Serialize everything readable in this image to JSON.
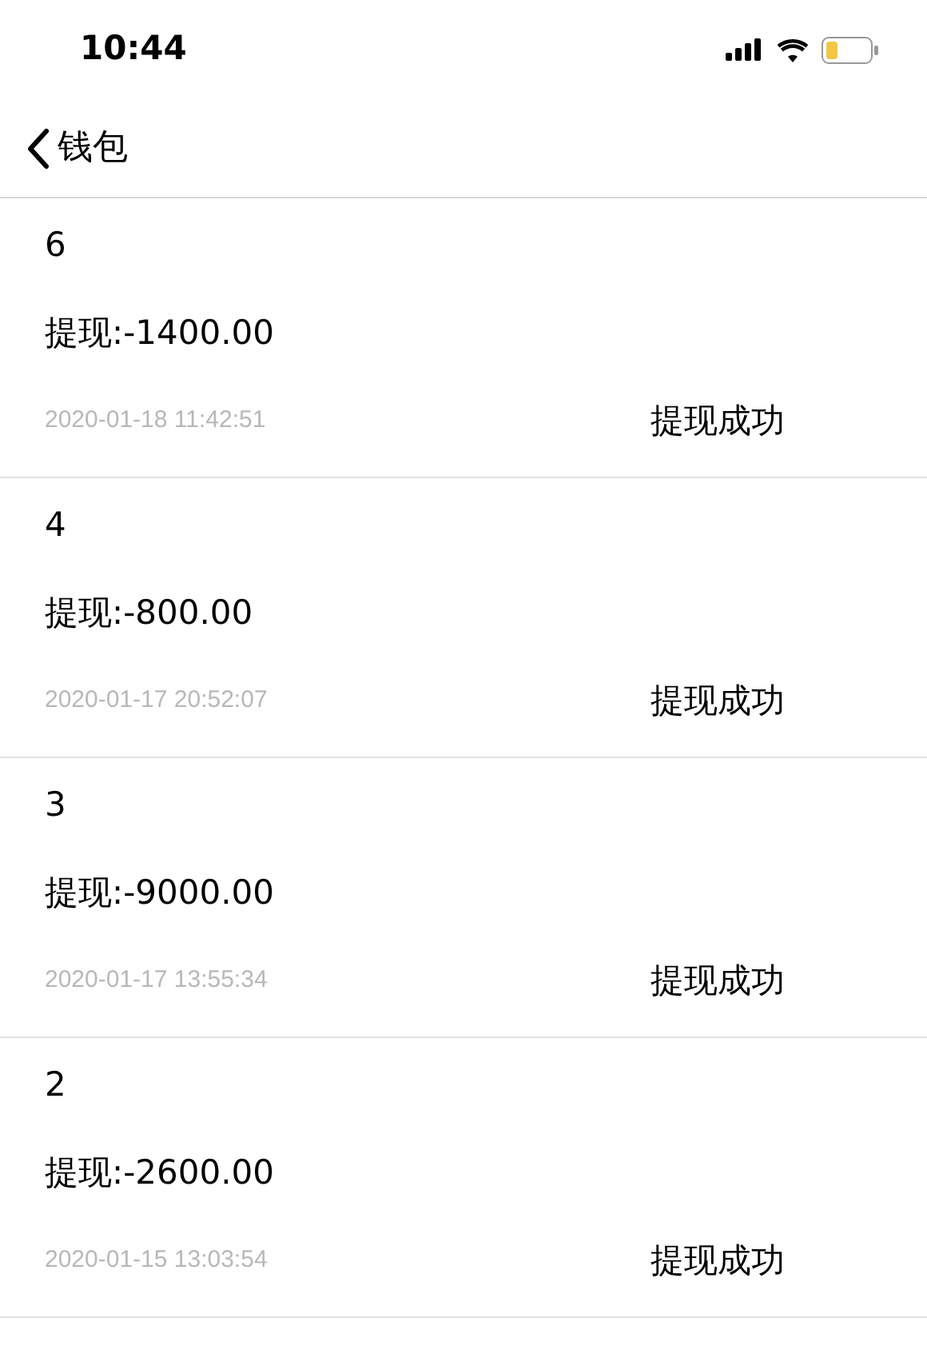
{
  "status_bar": {
    "time": "10:44"
  },
  "nav": {
    "back_label": "钱包"
  },
  "records": [
    {
      "number": "6",
      "amount": "提现:-1400.00",
      "date": "2020-01-18 11:42:51",
      "status": "提现成功"
    },
    {
      "number": "4",
      "amount": "提现:-800.00",
      "date": "2020-01-17 20:52:07",
      "status": "提现成功"
    },
    {
      "number": "3",
      "amount": "提现:-9000.00",
      "date": "2020-01-17 13:55:34",
      "status": "提现成功"
    },
    {
      "number": "2",
      "amount": "提现:-2600.00",
      "date": "2020-01-15 13:03:54",
      "status": "提现成功"
    }
  ]
}
